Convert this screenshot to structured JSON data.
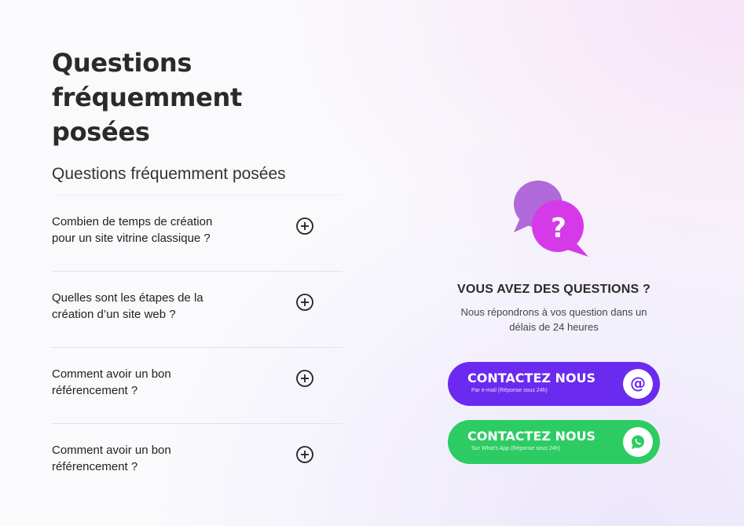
{
  "header": {
    "title_line1": "Questions",
    "title_line2": "fréquemment posées",
    "subtitle": "Questions fréquemment posées"
  },
  "faq": [
    {
      "q_line1": "Combien de temps de création",
      "q_line2": "pour un site vitrine classique ?"
    },
    {
      "q_line1": "Quelles sont les étapes de la",
      "q_line2": "création d’un site web ?"
    },
    {
      "q_line1": "Comment avoir un bon",
      "q_line2": "référencement ?"
    },
    {
      "q_line1": "Comment avoir un bon",
      "q_line2": "référencement ?"
    }
  ],
  "contact": {
    "title": "VOUS AVEZ DES QUESTIONS ?",
    "sub_line1": "Nous répondrons à vos question dans un",
    "sub_line2": "délais de 24 heures",
    "bubble_mark": "?",
    "email_button": {
      "label": "CONTACTEZ NOUS",
      "note": "Par e-mail (Réponse sous 24h)",
      "icon": "@"
    },
    "whatsapp_button": {
      "label": "CONTACTEZ NOUS",
      "note": "Sur What's App (Réponse sous 24h)"
    }
  },
  "colors": {
    "email_button": "#6a2af0",
    "whatsapp_button": "#2ccc62",
    "bubble_back": "#b069d8",
    "bubble_front": "#d63ae8"
  },
  "icons": {
    "faq_toggle": "plus-circle-icon",
    "contact_illustration": "chat-bubbles-question-icon",
    "email": "at-sign-icon",
    "whatsapp": "whatsapp-icon"
  }
}
